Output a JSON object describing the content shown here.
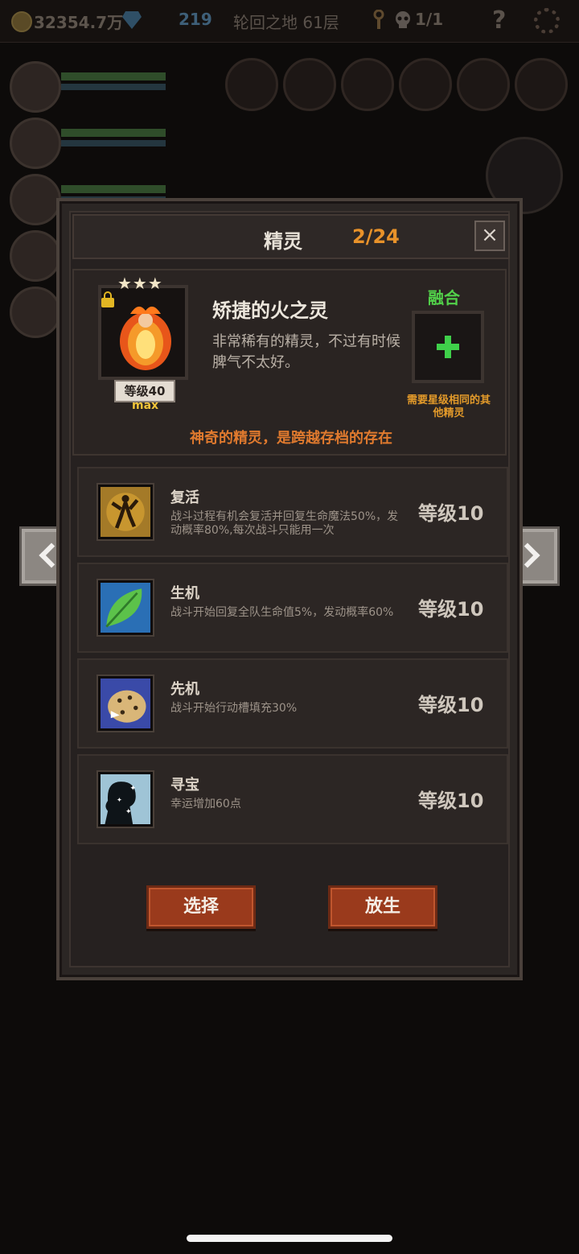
{
  "topbar": {
    "gold": "32354.7万",
    "gems": "219",
    "location": "轮回之地 61层",
    "keys": "1/1",
    "help": "?"
  },
  "modal": {
    "title": "精灵",
    "count": "2/24",
    "close": "×"
  },
  "spirit": {
    "stars": "★★★",
    "name": "矫捷的火之灵",
    "description": "非常稀有的精灵，不过有时候脾气不太好。",
    "level": "等级40",
    "max": "max",
    "fuse_label": "融合",
    "fuse_note": "需要星级相同的其他精灵",
    "magic_note": "神奇的精灵，是跨越存档的存在"
  },
  "skills": [
    {
      "name": "复活",
      "desc": "战斗过程有机会复活并回复生命魔法50%，发动概率80%,每次战斗只能用一次",
      "level": "等级10",
      "icon": "resurrect-icon"
    },
    {
      "name": "生机",
      "desc": "战斗开始回复全队生命值5%，发动概率60%",
      "level": "等级10",
      "icon": "leaf-icon"
    },
    {
      "name": "先机",
      "desc": "战斗开始行动槽填充30%",
      "level": "等级10",
      "icon": "leopard-icon"
    },
    {
      "name": "寻宝",
      "desc": "幸运增加60点",
      "level": "等级10",
      "icon": "luck-icon"
    }
  ],
  "buttons": {
    "select": "选择",
    "release": "放生"
  },
  "colors": {
    "accent_orange": "#e8922a",
    "fuse_green": "#52d14a",
    "button_red": "#9a3a1c"
  }
}
